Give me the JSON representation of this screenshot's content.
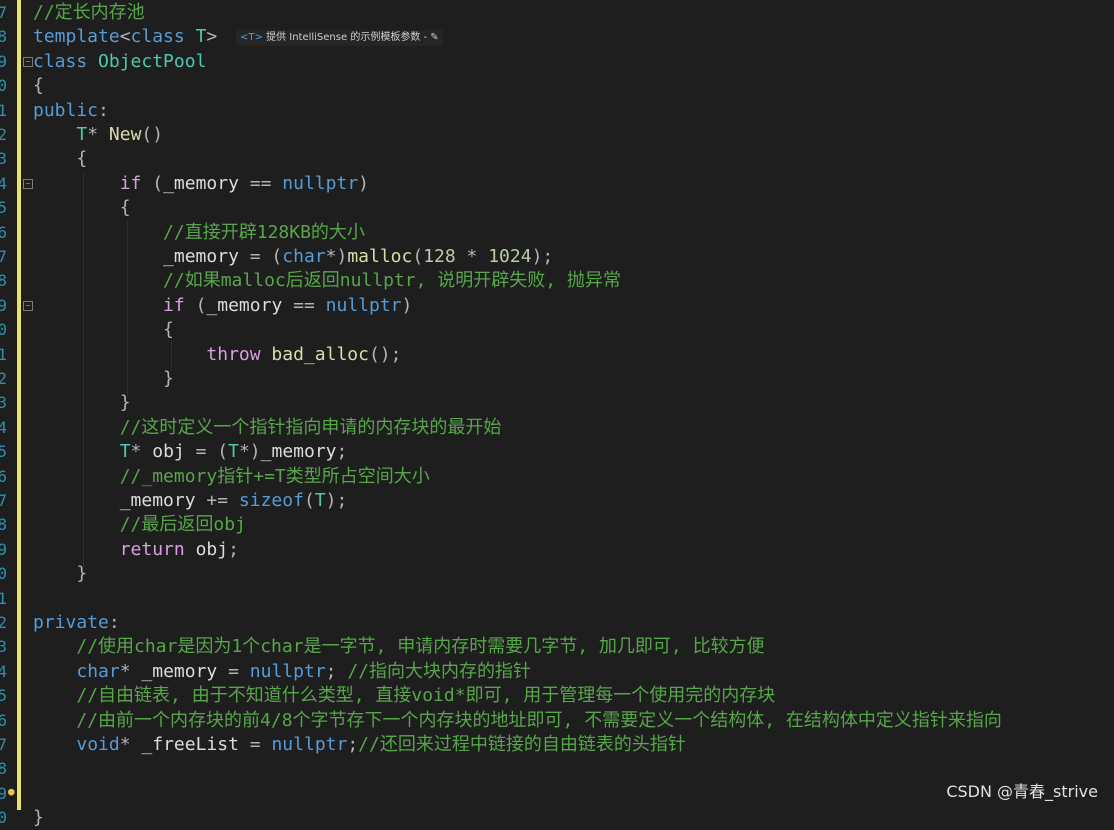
{
  "editor": {
    "line_numbers": [
      "7",
      "8",
      "9",
      "0",
      "1",
      "2",
      "3",
      "4",
      "5",
      "6",
      "7",
      "8",
      "9",
      "0",
      "1",
      "2",
      "3",
      "4",
      "5",
      "6",
      "7",
      "8",
      "9",
      "0",
      "1",
      "2",
      "3",
      "4",
      "5",
      "6",
      "7",
      "8",
      "9",
      "0"
    ],
    "inline_hint": {
      "tag": "<T>",
      "text": "提供 IntelliSense 的示例模板参数",
      "action": "- ✎"
    },
    "lines": [
      [
        {
          "c": "cm",
          "t": "//定长内存池"
        }
      ],
      [
        {
          "c": "kw",
          "t": "template"
        },
        {
          "c": "pun",
          "t": "<"
        },
        {
          "c": "kw",
          "t": "class"
        },
        {
          "c": "var",
          "t": " "
        },
        {
          "c": "tp",
          "t": "T"
        },
        {
          "c": "pun",
          "t": ">"
        }
      ],
      [
        {
          "c": "kw",
          "t": "class"
        },
        {
          "c": "var",
          "t": " "
        },
        {
          "c": "ty",
          "t": "ObjectPool"
        }
      ],
      [
        {
          "c": "pun",
          "t": "{"
        }
      ],
      [
        {
          "c": "kw",
          "t": "public"
        },
        {
          "c": "pun",
          "t": ":"
        }
      ],
      [
        {
          "c": "var",
          "t": "    "
        },
        {
          "c": "tp",
          "t": "T"
        },
        {
          "c": "pun",
          "t": "* "
        },
        {
          "c": "fn",
          "t": "New"
        },
        {
          "c": "pun",
          "t": "()"
        }
      ],
      [
        {
          "c": "var",
          "t": "    "
        },
        {
          "c": "pun",
          "t": "{"
        }
      ],
      [
        {
          "c": "var",
          "t": "        "
        },
        {
          "c": "kw2",
          "t": "if"
        },
        {
          "c": "var",
          "t": " "
        },
        {
          "c": "pun",
          "t": "("
        },
        {
          "c": "var",
          "t": "_memory "
        },
        {
          "c": "pun",
          "t": "== "
        },
        {
          "c": "kw",
          "t": "nullptr"
        },
        {
          "c": "pun",
          "t": ")"
        }
      ],
      [
        {
          "c": "var",
          "t": "        "
        },
        {
          "c": "pun",
          "t": "{"
        }
      ],
      [
        {
          "c": "var",
          "t": "            "
        },
        {
          "c": "cm",
          "t": "//直接开辟128KB的大小"
        }
      ],
      [
        {
          "c": "var",
          "t": "            _memory "
        },
        {
          "c": "pun",
          "t": "= ("
        },
        {
          "c": "kw",
          "t": "char"
        },
        {
          "c": "pun",
          "t": "*)"
        },
        {
          "c": "fn",
          "t": "malloc"
        },
        {
          "c": "pun",
          "t": "("
        },
        {
          "c": "num",
          "t": "128"
        },
        {
          "c": "pun",
          "t": " * "
        },
        {
          "c": "num",
          "t": "1024"
        },
        {
          "c": "pun",
          "t": ");"
        }
      ],
      [
        {
          "c": "var",
          "t": "            "
        },
        {
          "c": "cm",
          "t": "//如果malloc后返回nullptr, 说明开辟失败, 抛异常"
        }
      ],
      [
        {
          "c": "var",
          "t": "            "
        },
        {
          "c": "kw2",
          "t": "if"
        },
        {
          "c": "var",
          "t": " "
        },
        {
          "c": "pun",
          "t": "("
        },
        {
          "c": "var",
          "t": "_memory "
        },
        {
          "c": "pun",
          "t": "== "
        },
        {
          "c": "kw",
          "t": "nullptr"
        },
        {
          "c": "pun",
          "t": ")"
        }
      ],
      [
        {
          "c": "var",
          "t": "            "
        },
        {
          "c": "pun",
          "t": "{"
        }
      ],
      [
        {
          "c": "var",
          "t": "                "
        },
        {
          "c": "kw2",
          "t": "throw"
        },
        {
          "c": "var",
          "t": " "
        },
        {
          "c": "fn",
          "t": "bad_alloc"
        },
        {
          "c": "pun",
          "t": "();"
        }
      ],
      [
        {
          "c": "var",
          "t": "            "
        },
        {
          "c": "pun",
          "t": "}"
        }
      ],
      [
        {
          "c": "var",
          "t": "        "
        },
        {
          "c": "pun",
          "t": "}"
        }
      ],
      [
        {
          "c": "var",
          "t": "        "
        },
        {
          "c": "cm",
          "t": "//这时定义一个指针指向申请的内存块的最开始"
        }
      ],
      [
        {
          "c": "var",
          "t": "        "
        },
        {
          "c": "tp",
          "t": "T"
        },
        {
          "c": "pun",
          "t": "* "
        },
        {
          "c": "var",
          "t": "obj "
        },
        {
          "c": "pun",
          "t": "= ("
        },
        {
          "c": "tp",
          "t": "T"
        },
        {
          "c": "pun",
          "t": "*)"
        },
        {
          "c": "var",
          "t": "_memory"
        },
        {
          "c": "pun",
          "t": ";"
        }
      ],
      [
        {
          "c": "var",
          "t": "        "
        },
        {
          "c": "cm",
          "t": "//_memory指针+=T类型所占空间大小"
        }
      ],
      [
        {
          "c": "var",
          "t": "        _memory "
        },
        {
          "c": "pun",
          "t": "+= "
        },
        {
          "c": "kw",
          "t": "sizeof"
        },
        {
          "c": "pun",
          "t": "("
        },
        {
          "c": "tp",
          "t": "T"
        },
        {
          "c": "pun",
          "t": ");"
        }
      ],
      [
        {
          "c": "var",
          "t": "        "
        },
        {
          "c": "cm",
          "t": "//最后返回obj"
        }
      ],
      [
        {
          "c": "var",
          "t": "        "
        },
        {
          "c": "kw2",
          "t": "return"
        },
        {
          "c": "var",
          "t": " obj"
        },
        {
          "c": "pun",
          "t": ";"
        }
      ],
      [
        {
          "c": "var",
          "t": "    "
        },
        {
          "c": "pun",
          "t": "}"
        }
      ],
      [],
      [
        {
          "c": "kw",
          "t": "private"
        },
        {
          "c": "pun",
          "t": ":"
        }
      ],
      [
        {
          "c": "var",
          "t": "    "
        },
        {
          "c": "cm",
          "t": "//使用char是因为1个char是一字节, 申请内存时需要几字节, 加几即可, 比较方便"
        }
      ],
      [
        {
          "c": "var",
          "t": "    "
        },
        {
          "c": "kw",
          "t": "char"
        },
        {
          "c": "pun",
          "t": "* "
        },
        {
          "c": "var",
          "t": "_memory "
        },
        {
          "c": "pun",
          "t": "= "
        },
        {
          "c": "kw",
          "t": "nullptr"
        },
        {
          "c": "pun",
          "t": "; "
        },
        {
          "c": "cm",
          "t": "//指向大块内存的指针"
        }
      ],
      [
        {
          "c": "var",
          "t": "    "
        },
        {
          "c": "cm",
          "t": "//自由链表, 由于不知道什么类型, 直接void*即可, 用于管理每一个使用完的内存块"
        }
      ],
      [
        {
          "c": "var",
          "t": "    "
        },
        {
          "c": "cm",
          "t": "//由前一个内存块的前4/8个字节存下一个内存块的地址即可, 不需要定义一个结构体, 在结构体中定义指针来指向"
        }
      ],
      [
        {
          "c": "var",
          "t": "    "
        },
        {
          "c": "kw",
          "t": "void"
        },
        {
          "c": "pun",
          "t": "* "
        },
        {
          "c": "var",
          "t": "_freeList "
        },
        {
          "c": "pun",
          "t": "= "
        },
        {
          "c": "kw",
          "t": "nullptr"
        },
        {
          "c": "pun",
          "t": ";"
        },
        {
          "c": "cm",
          "t": "//还回来过程中链接的自由链表的头指针"
        }
      ],
      [],
      [],
      [
        {
          "c": "pun",
          "t": "}"
        }
      ]
    ]
  },
  "watermark": "CSDN @青春_strive"
}
